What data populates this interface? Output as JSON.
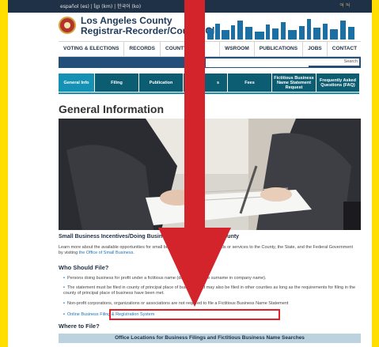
{
  "top_bar": {
    "languages": "español (es) | ខ្មែរ (km) | 한국어 (ko)",
    "icons": [
      "accessibility-icon",
      "accessibility-icon"
    ]
  },
  "header": {
    "title_line1": "Los Angeles County",
    "title_line2": "Registrar-Recorder/County Cle"
  },
  "nav": {
    "items": [
      "VOTING & ELECTIONS",
      "RECORDS",
      "COUNTY CLE",
      "WSROOM",
      "PUBLICATIONS",
      "JOBS",
      "CONTACT"
    ]
  },
  "search": {
    "button_label": "Search",
    "placeholder": ""
  },
  "tabs": [
    {
      "label": "General Info",
      "active": true
    },
    {
      "label": "Filing",
      "active": false
    },
    {
      "label": "Publication",
      "active": false
    },
    {
      "label": "s",
      "active": false
    },
    {
      "label": "Fees",
      "active": false
    },
    {
      "label": "Fictitious Business Name Statement Request",
      "active": false
    },
    {
      "label": "Frequently Asked Questions (FAQ)",
      "active": false
    }
  ],
  "main": {
    "heading": "General Information",
    "section_title": "Small Business Incentives/Doing Business with Los Angeles County",
    "intro_text": "Learn more about the available opportunities for small businesses looking to sell goods or services to the County, the State, and the Federal Government by visiting ",
    "intro_link": "the Office of Small Business.",
    "who_heading": "Who Should File?",
    "bullets": [
      "Persons doing business for profit under a fictitious name (does not include surname in company name).",
      "The statement must be filed in county of principal place of business and may also be filed in other counties as long as the requirements for filing in the county of principal place of business have been met.",
      "Non-profit corporations, organizations or associations are not required to file a Fictitious Business Name Statement"
    ],
    "online_link": "Online Business Filing & Registration System",
    "where_heading": "Where to File?",
    "office_bar": "Office Locations for Business Filings and Fictitious Business Name Searches"
  },
  "colors": {
    "background_frame": "#ffde00",
    "highlight": "#e0232a",
    "tab_active": "#1591b3",
    "tab": "#0c5d71"
  }
}
